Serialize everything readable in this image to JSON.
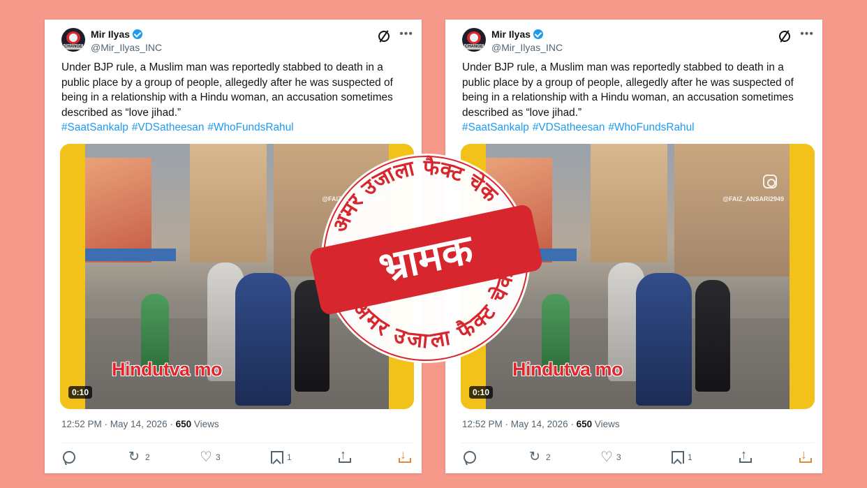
{
  "tweet": {
    "author_name": "Mir Ilyas",
    "handle": "@Mir_Ilyas_INC",
    "avatar_text": "CHANGE",
    "text_line1": "Under BJP rule, a Muslim man was reportedly stabbed to death in a",
    "text_line2": "public place by a group of people, allegedly after he was suspected of",
    "text_line3": "being in a relationship with a Hindu woman, an accusation sometimes",
    "text_line4": "described as “love jihad.”",
    "hashtags": [
      "#SaatSankalp",
      "#VDSatheesan",
      "#WhoFundsRahul"
    ],
    "video": {
      "caption": "Hindutva mo",
      "watermark": "@FAIZ_ANSARI2949",
      "timecode": "0:10"
    },
    "time": "12:52 PM",
    "separator": " · ",
    "date": "May 14, 2026",
    "views_count": "650",
    "views_label": " Views",
    "actions": {
      "reply_count": "",
      "repost_count": "2",
      "like_count": "3",
      "bookmark_count": "1"
    }
  },
  "stamp": {
    "top_arc": "अमर उजाला फैक्ट चेक",
    "bottom_arc": "अमर उजाला फैक्ट चेक",
    "verdict": "भ्रामक",
    "color": "#d8262e"
  },
  "colors": {
    "background": "#f6988a",
    "link": "#1d9bf0",
    "verified": "#1d9bf0",
    "video_border": "#f2c21b"
  }
}
